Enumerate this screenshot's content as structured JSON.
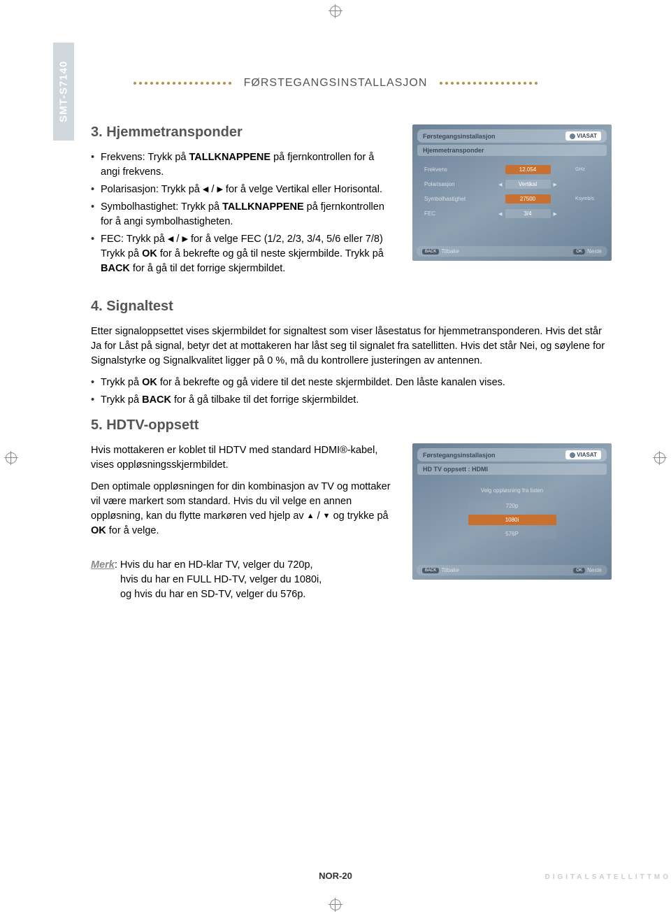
{
  "sidebar": {
    "model": "SMT-S7140"
  },
  "header": {
    "title": "FØRSTEGANGSINSTALLASJON"
  },
  "section3": {
    "heading": "3. Hjemmetransponder",
    "items": [
      {
        "before": "Frekvens: Trykk på ",
        "bold1": "TALLKNAPPENE",
        "after": " på fjernkontrollen for å angi frekvens."
      },
      {
        "before": "Polarisasjon: Trykk på ",
        "arrows": "lr",
        "after": " for å velge Vertikal eller Horisontal."
      },
      {
        "before": "Symbolhastighet: Trykk på ",
        "bold1": "TALLKNAPPENE",
        "after": " på fjernkontrollen for å angi symbolhastigheten."
      },
      {
        "before": "FEC: Trykk på ",
        "arrows": "lr",
        "mid": " for å velge FEC (1/2, 2/3, 3/4, 5/6 eller 7/8) Trykk på ",
        "bold1": "OK",
        "mid2": " for å bekrefte og gå til neste skjermbilde. Trykk på ",
        "bold2": "BACK",
        "after": " for å gå til det forrige skjermbildet."
      }
    ]
  },
  "screenshot1": {
    "title": "Førstegangsinstallasjon",
    "subtitle": "Hjemmetransponder",
    "brand": "VIASAT",
    "rows": [
      {
        "label": "Frekvens",
        "value": "12.054",
        "unit": "GHz",
        "style": "orange"
      },
      {
        "label": "Polarisasjon",
        "value": "Vertikal",
        "unit": "",
        "style": "light",
        "lr": true
      },
      {
        "label": "Symbolhastighet",
        "value": "27500",
        "unit": "Ksymb/s",
        "style": "orange"
      },
      {
        "label": "FEC",
        "value": "3/4",
        "unit": "",
        "style": "light",
        "lr": true
      }
    ],
    "footer": {
      "back": "Tilbake",
      "back_chip": "BACK",
      "ok": "Neste",
      "ok_chip": "OK"
    }
  },
  "section4": {
    "heading": "4. Signaltest",
    "para": "Etter signaloppsettet vises skjermbildet for signaltest som viser låsestatus for hjemmetransponderen. Hvis det står Ja for Låst på signal, betyr det at mottakeren har låst seg til signalet fra satellitten. Hvis det står Nei, og søylene for Signalstyrke og Signalkvalitet ligger på 0 %, må du kontrollere justeringen av antennen.",
    "items": [
      {
        "before": "Trykk på ",
        "bold1": "OK",
        "after": " for å bekrefte og gå videre til det neste skjermbildet. Den låste kanalen vises."
      },
      {
        "before": "Trykk på ",
        "bold1": "BACK",
        "after": " for å gå tilbake til det forrige skjermbildet."
      }
    ]
  },
  "section5": {
    "heading": "5. HDTV-oppsett",
    "para1": "Hvis mottakeren er koblet til HDTV med standard HDMI®-kabel, vises oppløsningsskjermbildet.",
    "para2_before": "Den optimale oppløsningen for din kombinasjon av TV og mottaker vil være markert som standard. Hvis du vil velge en annen oppløsning, kan du flytte markøren ved hjelp av ",
    "para2_mid": " og trykke på ",
    "para2_bold": "OK",
    "para2_after": " for å velge."
  },
  "screenshot2": {
    "title": "Førstegangsinstallasjon",
    "subtitle": "HD TV oppsett : HDMI",
    "brand": "VIASAT",
    "prompt": "Velg oppløsning fra listen",
    "options": [
      {
        "label": "720p",
        "style": "alt"
      },
      {
        "label": "1080i",
        "style": "sel"
      },
      {
        "label": "576P",
        "style": "alt"
      }
    ],
    "footer": {
      "back": "Tilbake",
      "back_chip": "BACK",
      "ok": "Neste",
      "ok_chip": "OK"
    }
  },
  "merk": {
    "label": "Merk",
    "text": ": Hvis du har en HD-klar TV, velger du 720p, hvis du har en FULL HD-TV, velger du 1080i, og hvis du har en SD-TV, velger du 576p."
  },
  "footer": {
    "page": "NOR-20",
    "right": "DIGITALSATELLITTMO"
  }
}
